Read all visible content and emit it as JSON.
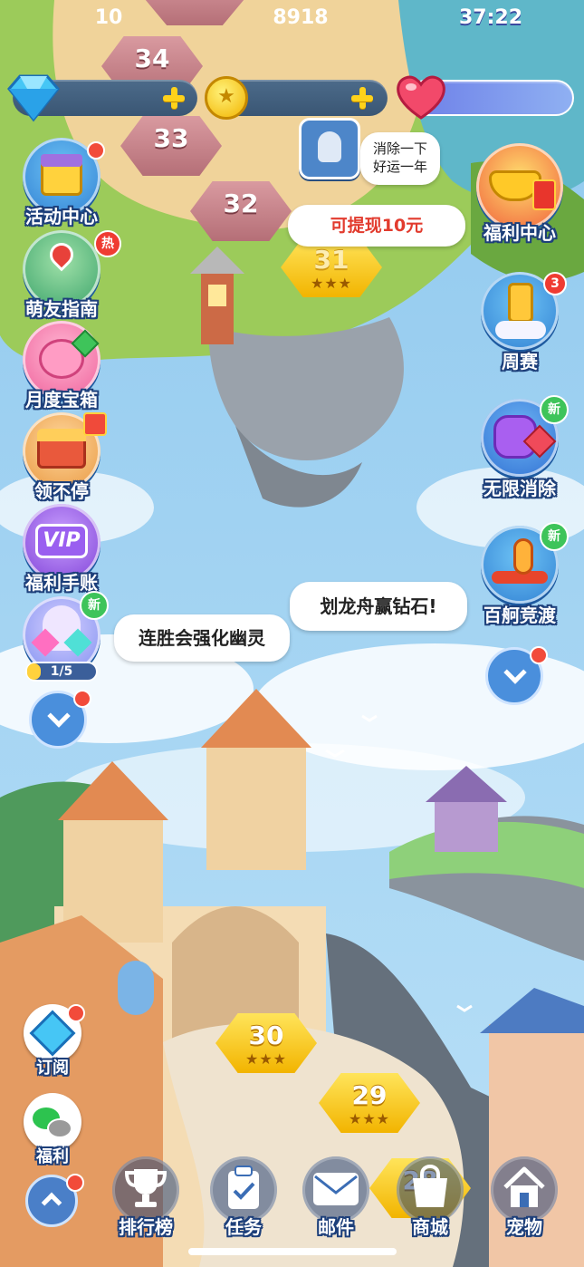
{
  "top_bar": {
    "diamonds": "10",
    "coins": "8918",
    "lives_timer": "37:22"
  },
  "levels": [
    {
      "number": "34",
      "state": "locked"
    },
    {
      "number": "33",
      "state": "locked"
    },
    {
      "number": "32",
      "state": "locked"
    },
    {
      "number": "31",
      "state": "current"
    },
    {
      "number": "30",
      "state": "cleared",
      "stars": "★★★"
    },
    {
      "number": "29",
      "state": "cleared",
      "stars": "★★★"
    },
    {
      "number": "28",
      "state": "cleared"
    }
  ],
  "current_level_stars": "★★★",
  "friend_bubble": {
    "line1": "消除一下",
    "line2": "好运一年"
  },
  "cash_bubble": "可提现10元",
  "left_menu": [
    {
      "label": "活动中心",
      "icon": "gift-box-icon"
    },
    {
      "label": "萌友指南",
      "icon": "map-pin-icon",
      "badge": "热"
    },
    {
      "label": "月度宝箱",
      "icon": "pig-treasure-icon"
    },
    {
      "label": "领不停",
      "icon": "treasure-chest-icon"
    },
    {
      "label": "福利手账",
      "icon": "vip-icon"
    }
  ],
  "ghost_event": {
    "badge": "新",
    "progress": "1/5",
    "bubble": "连胜会强化幽灵"
  },
  "right_menu": [
    {
      "label": "福利中心",
      "icon": "gold-ingot-icon"
    },
    {
      "label": "周赛",
      "icon": "trophy-cup-icon",
      "badge": "3"
    },
    {
      "label": "无限消除",
      "icon": "purple-cat-icon",
      "badge": "新"
    },
    {
      "label": "百舸竞渡",
      "icon": "dragon-boat-icon",
      "badge": "新"
    }
  ],
  "dragon_bubble": "划龙舟赢钻石!",
  "subscribe": {
    "label": "订阅"
  },
  "welfare": {
    "label": "福利"
  },
  "bottom_nav": [
    {
      "label": "排行榜",
      "icon": "trophy-icon"
    },
    {
      "label": "任务",
      "icon": "clipboard-icon"
    },
    {
      "label": "邮件",
      "icon": "mail-icon"
    },
    {
      "label": "商城",
      "icon": "shopping-bag-icon"
    },
    {
      "label": "宠物",
      "icon": "house-icon"
    }
  ],
  "colors": {
    "accent_gold": "#f2b400",
    "button_blue": "#2f7fd2",
    "badge_red": "#f24b3a",
    "badge_green": "#3ec45a"
  }
}
